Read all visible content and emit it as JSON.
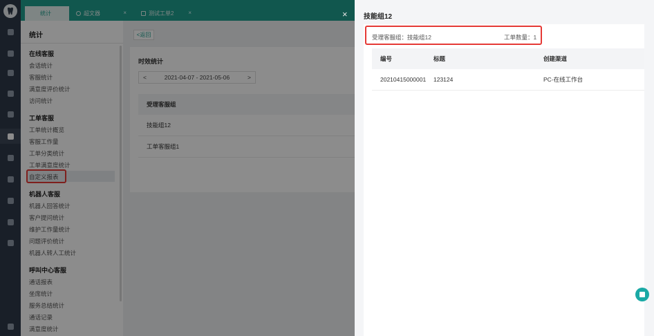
{
  "tabs": [
    {
      "label": "统计",
      "close": "×"
    },
    {
      "label": "超文器",
      "close": "×"
    },
    {
      "label": "测试工单2",
      "close": "×"
    }
  ],
  "menu": {
    "title": "统计",
    "groups": [
      {
        "title": "在线客服",
        "items": [
          "会话统计",
          "客服统计",
          "满意度评价统计",
          "访问统计"
        ]
      },
      {
        "title": "工单客服",
        "items": [
          "工单统计概览",
          "客服工作量",
          "工单分类统计",
          "工单满意度统计",
          "自定义报表"
        ]
      },
      {
        "title": "机器人客服",
        "items": [
          "机器人回答统计",
          "客户提问统计",
          "维护工作量统计",
          "问题评价统计",
          "机器人转人工统计"
        ]
      },
      {
        "title": "呼叫中心客服",
        "items": [
          "通话报表",
          "坐席统计",
          "服务总结统计",
          "通话记录",
          "满意度统计"
        ]
      }
    ]
  },
  "main": {
    "back_label": "<返回",
    "card_title": "时效统计",
    "date_prev": "<",
    "date_range": "2021-04-07 - 2021-05-06",
    "date_next": ">",
    "column_header": "受理客服组",
    "rows": [
      "技能组12",
      "工单客服组1"
    ]
  },
  "mask_close": "×",
  "drawer": {
    "title": "技能组12",
    "group_info": "受理客服组：技能组12",
    "count_info": "工单数量：1",
    "columns": [
      "编号",
      "标题",
      "创建渠道"
    ],
    "rows": [
      {
        "id": "20210415000001",
        "title": "123124",
        "channel": "PC-在线工作台"
      }
    ]
  },
  "colors": {
    "accent": "#1f9e8e",
    "highlight_box": "#e53935",
    "rail": "#2f3a4a"
  },
  "icons": {
    "rail": [
      "home-icon",
      "grid-icon",
      "document-icon",
      "chat-icon",
      "user-icon",
      "bar-chart-icon",
      "search-icon",
      "settings-icon",
      "video-icon",
      "target-icon",
      "shield-icon",
      "notification-icon"
    ],
    "help": "help-chat-icon"
  }
}
